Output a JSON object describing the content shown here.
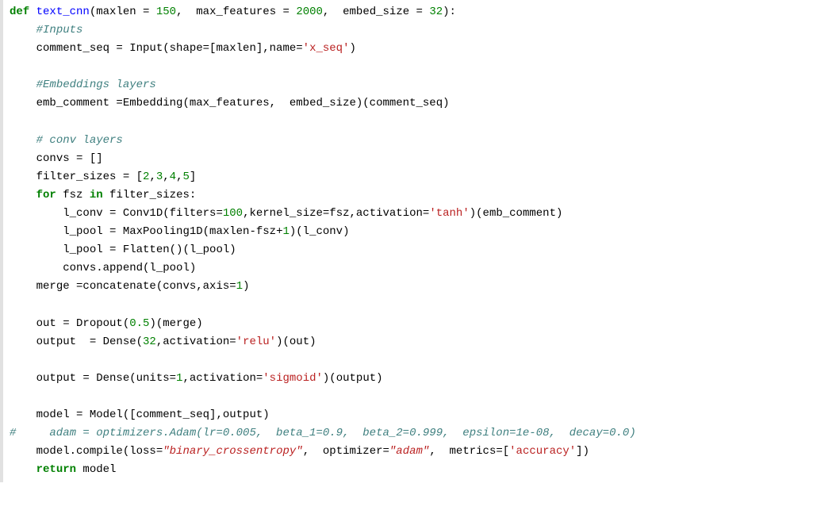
{
  "code": {
    "lines": [
      {
        "type": "def",
        "indent": 0,
        "tokens": [
          {
            "t": "kw",
            "v": "def"
          },
          {
            "t": "plain",
            "v": " "
          },
          {
            "t": "fname",
            "v": "text_cnn"
          },
          {
            "t": "plain",
            "v": "(maxlen = "
          },
          {
            "t": "num",
            "v": "150"
          },
          {
            "t": "plain",
            "v": ",  max_features = "
          },
          {
            "t": "num",
            "v": "2000"
          },
          {
            "t": "plain",
            "v": ",  embed_size = "
          },
          {
            "t": "num",
            "v": "32"
          },
          {
            "t": "plain",
            "v": "):"
          }
        ]
      },
      {
        "type": "comment",
        "indent": 1,
        "tokens": [
          {
            "t": "comment",
            "v": "#Inputs"
          }
        ]
      },
      {
        "type": "stmt",
        "indent": 1,
        "tokens": [
          {
            "t": "plain",
            "v": "comment_seq = Input(shape=[maxlen],name="
          },
          {
            "t": "str",
            "v": "'x_seq'"
          },
          {
            "t": "plain",
            "v": ")"
          }
        ]
      },
      {
        "type": "blank",
        "indent": 0,
        "tokens": []
      },
      {
        "type": "comment",
        "indent": 1,
        "tokens": [
          {
            "t": "comment",
            "v": "#Embeddings layers"
          }
        ]
      },
      {
        "type": "stmt",
        "indent": 1,
        "tokens": [
          {
            "t": "plain",
            "v": "emb_comment =Embedding(max_features,  embed_size)(comment_seq)"
          }
        ]
      },
      {
        "type": "blank",
        "indent": 0,
        "tokens": []
      },
      {
        "type": "comment",
        "indent": 1,
        "tokens": [
          {
            "t": "comment",
            "v": "# conv layers"
          }
        ]
      },
      {
        "type": "stmt",
        "indent": 1,
        "tokens": [
          {
            "t": "plain",
            "v": "convs = []"
          }
        ]
      },
      {
        "type": "stmt",
        "indent": 1,
        "tokens": [
          {
            "t": "plain",
            "v": "filter_sizes = ["
          },
          {
            "t": "num",
            "v": "2"
          },
          {
            "t": "plain",
            "v": ","
          },
          {
            "t": "num",
            "v": "3"
          },
          {
            "t": "plain",
            "v": ","
          },
          {
            "t": "num",
            "v": "4"
          },
          {
            "t": "plain",
            "v": ","
          },
          {
            "t": "num",
            "v": "5"
          },
          {
            "t": "plain",
            "v": "]"
          }
        ]
      },
      {
        "type": "stmt",
        "indent": 1,
        "tokens": [
          {
            "t": "kw",
            "v": "for"
          },
          {
            "t": "plain",
            "v": " fsz "
          },
          {
            "t": "kw",
            "v": "in"
          },
          {
            "t": "plain",
            "v": " filter_sizes:"
          }
        ]
      },
      {
        "type": "stmt",
        "indent": 2,
        "tokens": [
          {
            "t": "plain",
            "v": "l_conv = Conv1D(filters="
          },
          {
            "t": "num",
            "v": "100"
          },
          {
            "t": "plain",
            "v": ",kernel_size=fsz,activation="
          },
          {
            "t": "str",
            "v": "'tanh'"
          },
          {
            "t": "plain",
            "v": ")(emb_comment)"
          }
        ]
      },
      {
        "type": "stmt",
        "indent": 2,
        "tokens": [
          {
            "t": "plain",
            "v": "l_pool = MaxPooling1D(maxlen-fsz+"
          },
          {
            "t": "num",
            "v": "1"
          },
          {
            "t": "plain",
            "v": ")(l_conv)"
          }
        ]
      },
      {
        "type": "stmt",
        "indent": 2,
        "tokens": [
          {
            "t": "plain",
            "v": "l_pool = Flatten()(l_pool)"
          }
        ]
      },
      {
        "type": "stmt",
        "indent": 2,
        "tokens": [
          {
            "t": "plain",
            "v": "convs.append(l_pool)"
          }
        ]
      },
      {
        "type": "stmt",
        "indent": 1,
        "tokens": [
          {
            "t": "plain",
            "v": "merge =concatenate(convs,axis="
          },
          {
            "t": "num",
            "v": "1"
          },
          {
            "t": "plain",
            "v": ")"
          }
        ]
      },
      {
        "type": "blank",
        "indent": 0,
        "tokens": []
      },
      {
        "type": "stmt",
        "indent": 1,
        "tokens": [
          {
            "t": "plain",
            "v": "out = Dropout("
          },
          {
            "t": "num",
            "v": "0.5"
          },
          {
            "t": "plain",
            "v": ")(merge)"
          }
        ]
      },
      {
        "type": "stmt",
        "indent": 1,
        "tokens": [
          {
            "t": "plain",
            "v": "output  = Dense("
          },
          {
            "t": "num",
            "v": "32"
          },
          {
            "t": "plain",
            "v": ",activation="
          },
          {
            "t": "str",
            "v": "'relu'"
          },
          {
            "t": "plain",
            "v": ")(out)"
          }
        ]
      },
      {
        "type": "blank",
        "indent": 0,
        "tokens": []
      },
      {
        "type": "stmt",
        "indent": 1,
        "tokens": [
          {
            "t": "plain",
            "v": "output = Dense(units="
          },
          {
            "t": "num",
            "v": "1"
          },
          {
            "t": "plain",
            "v": ",activation="
          },
          {
            "t": "str",
            "v": "'sigmoid'"
          },
          {
            "t": "plain",
            "v": ")(output)"
          }
        ]
      },
      {
        "type": "blank",
        "indent": 0,
        "tokens": []
      },
      {
        "type": "stmt",
        "indent": 1,
        "tokens": [
          {
            "t": "plain",
            "v": "model = Model([comment_seq],output)"
          }
        ]
      },
      {
        "type": "comment",
        "indent": 0,
        "tokens": [
          {
            "t": "comment",
            "v": "#     adam = optimizers.Adam(lr=0.005,  beta_1=0.9,  beta_2=0.999,  epsilon=1e-08,  decay=0.0)"
          }
        ]
      },
      {
        "type": "stmt",
        "indent": 1,
        "tokens": [
          {
            "t": "plain",
            "v": "model.compile(loss="
          },
          {
            "t": "strd",
            "v": "\"binary_crossentropy\""
          },
          {
            "t": "plain",
            "v": ",  optimizer="
          },
          {
            "t": "strd",
            "v": "\"adam\""
          },
          {
            "t": "plain",
            "v": ",  metrics=["
          },
          {
            "t": "str",
            "v": "'accuracy'"
          },
          {
            "t": "plain",
            "v": "])"
          }
        ]
      },
      {
        "type": "stmt",
        "indent": 1,
        "tokens": [
          {
            "t": "kw",
            "v": "return"
          },
          {
            "t": "plain",
            "v": " model"
          }
        ]
      }
    ]
  }
}
